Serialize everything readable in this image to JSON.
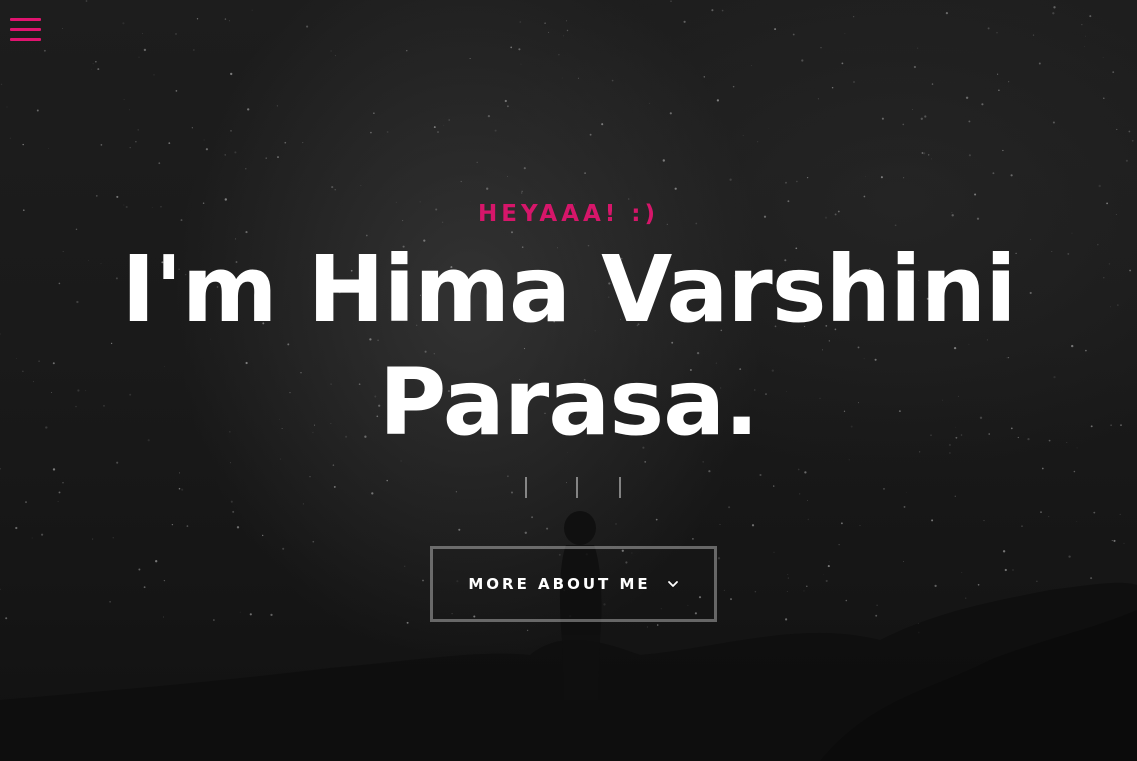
{
  "header": {
    "menu_icon": "hamburger-menu-icon",
    "accent_color": "#e0146f"
  },
  "intro": {
    "pretitle": "HEYAAA! :)",
    "title_line1": "I'm Hima Varshini",
    "title_line2": "Parasa."
  },
  "social": {
    "icons": [
      "social-link-icon",
      "social-link-icon",
      "social-link-icon"
    ]
  },
  "cta": {
    "label": "MORE ABOUT ME",
    "icon": "chevron-down-icon"
  },
  "colors": {
    "background": "#1a1a1a",
    "text": "#ffffff",
    "accent": "#d6166a"
  }
}
